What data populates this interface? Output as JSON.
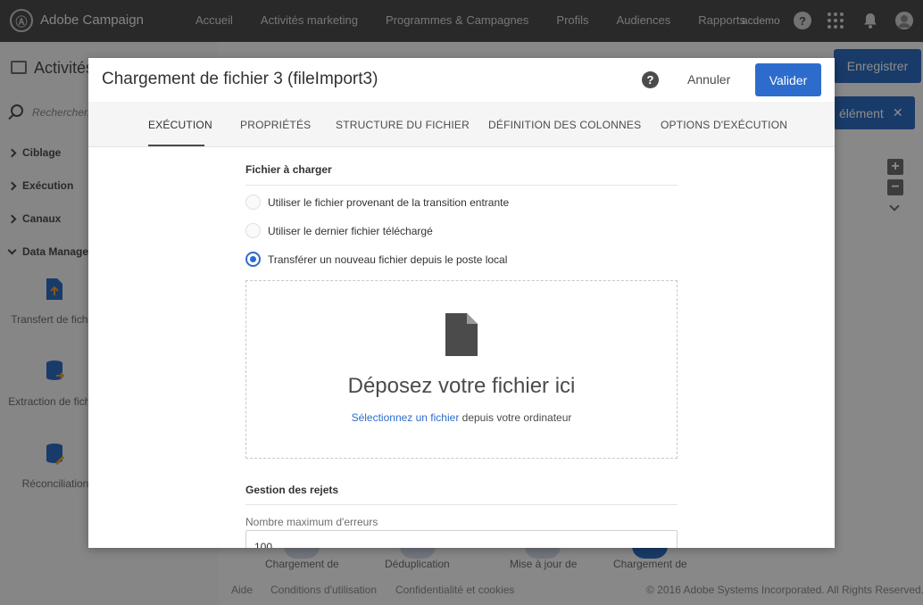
{
  "app": {
    "brand": "Adobe Campaign",
    "logo_glyph": "Ⓐ",
    "nav": [
      "Accueil",
      "Activités marketing",
      "Programmes & Campagnes",
      "Profils",
      "Audiences",
      "Rapports"
    ],
    "user": "acdemo",
    "help_glyph": "?"
  },
  "left_panel": {
    "title": "Activités",
    "search_placeholder": "Rechercher...",
    "categories": [
      "Ciblage",
      "Exécution",
      "Canaux",
      "Data Management"
    ],
    "tools": [
      {
        "label": "Transfert de fichier"
      },
      {
        "label": "Extraction de fichier"
      },
      {
        "label": "Réconciliation"
      }
    ]
  },
  "canvas": {
    "save_button": "Enregistrer",
    "element_button": "élément",
    "close_glyph": "✕",
    "zoom_in": "+",
    "zoom_out": "−",
    "nodes": [
      "Chargement de",
      "Déduplication",
      "Mise à jour de",
      "Chargement de"
    ],
    "footer_links": [
      "Aide",
      "Conditions d'utilisation",
      "Confidentialité et cookies"
    ],
    "copyright": "© 2016 Adobe Systems Incorporated. All Rights Reserved."
  },
  "modal": {
    "title": "Chargement de fichier 3 (fileImport3)",
    "help_glyph": "?",
    "cancel": "Annuler",
    "validate": "Valider",
    "tabs": [
      {
        "label": "EXÉCUTION",
        "active": true
      },
      {
        "label": "PROPRIÉTÉS",
        "active": false
      },
      {
        "label": "STRUCTURE DU FICHIER",
        "active": false
      },
      {
        "label": "DÉFINITION DES COLONNES",
        "active": false
      },
      {
        "label": "OPTIONS D'EXÉCUTION",
        "active": false
      }
    ],
    "file_section": {
      "title": "Fichier à charger",
      "options": [
        {
          "label": "Utiliser le fichier provenant de la transition entrante",
          "checked": false
        },
        {
          "label": "Utiliser le dernier fichier téléchargé",
          "checked": false
        },
        {
          "label": "Transférer un nouveau fichier depuis le poste local",
          "checked": true
        }
      ],
      "dropzone": {
        "title": "Déposez votre fichier ici",
        "link": "Sélectionnez un fichier",
        "suffix": " depuis votre ordinateur"
      }
    },
    "rejects_section": {
      "title": "Gestion des rejets",
      "max_errors_label": "Nombre maximum d'erreurs",
      "max_errors_value": "100"
    }
  },
  "colors": {
    "accent": "#2d6ccc",
    "topbar": "#4b4b4b"
  }
}
